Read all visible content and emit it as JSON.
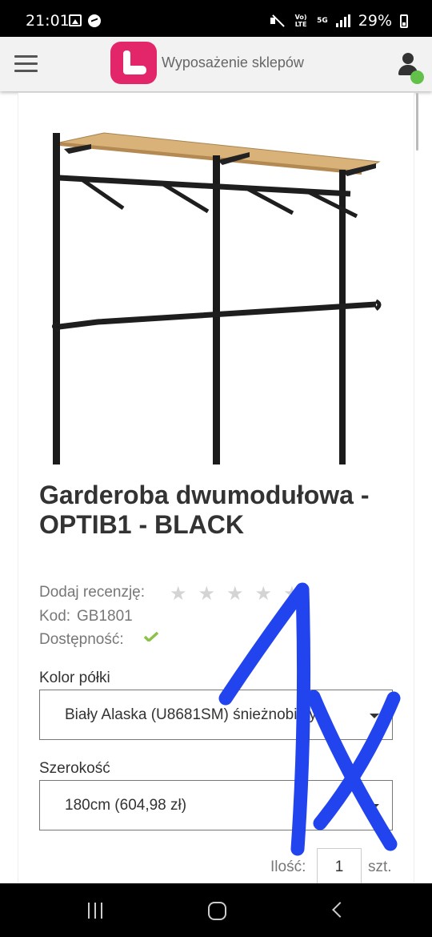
{
  "status_bar": {
    "time": "21:01",
    "battery": "29%",
    "network": "5G",
    "volte": "Vo) LTE"
  },
  "header": {
    "brand_text": "Wyposażenie sklepów",
    "brand_color": "#e3266a"
  },
  "product": {
    "title": "Garderoba dwumodułowa - OPTIB1 - BLACK",
    "review_label": "Dodaj recenzję:",
    "stars_total": 5,
    "code_label": "Kod:",
    "code_value": "GB1801",
    "availability_label": "Dostępność:",
    "availability_color": "#8bc34a"
  },
  "options": {
    "shelf_color_label": "Kolor półki",
    "shelf_color_value": "Biały Alaska (U8681SM) śnieżnobiały",
    "width_label": "Szerokość",
    "width_value": "180cm (604,98 zł)"
  },
  "quantity": {
    "label": "Ilość:",
    "value": "1",
    "unit": "szt."
  },
  "annotation": {
    "handwritten_text": "1x",
    "color": "#2244ee"
  }
}
